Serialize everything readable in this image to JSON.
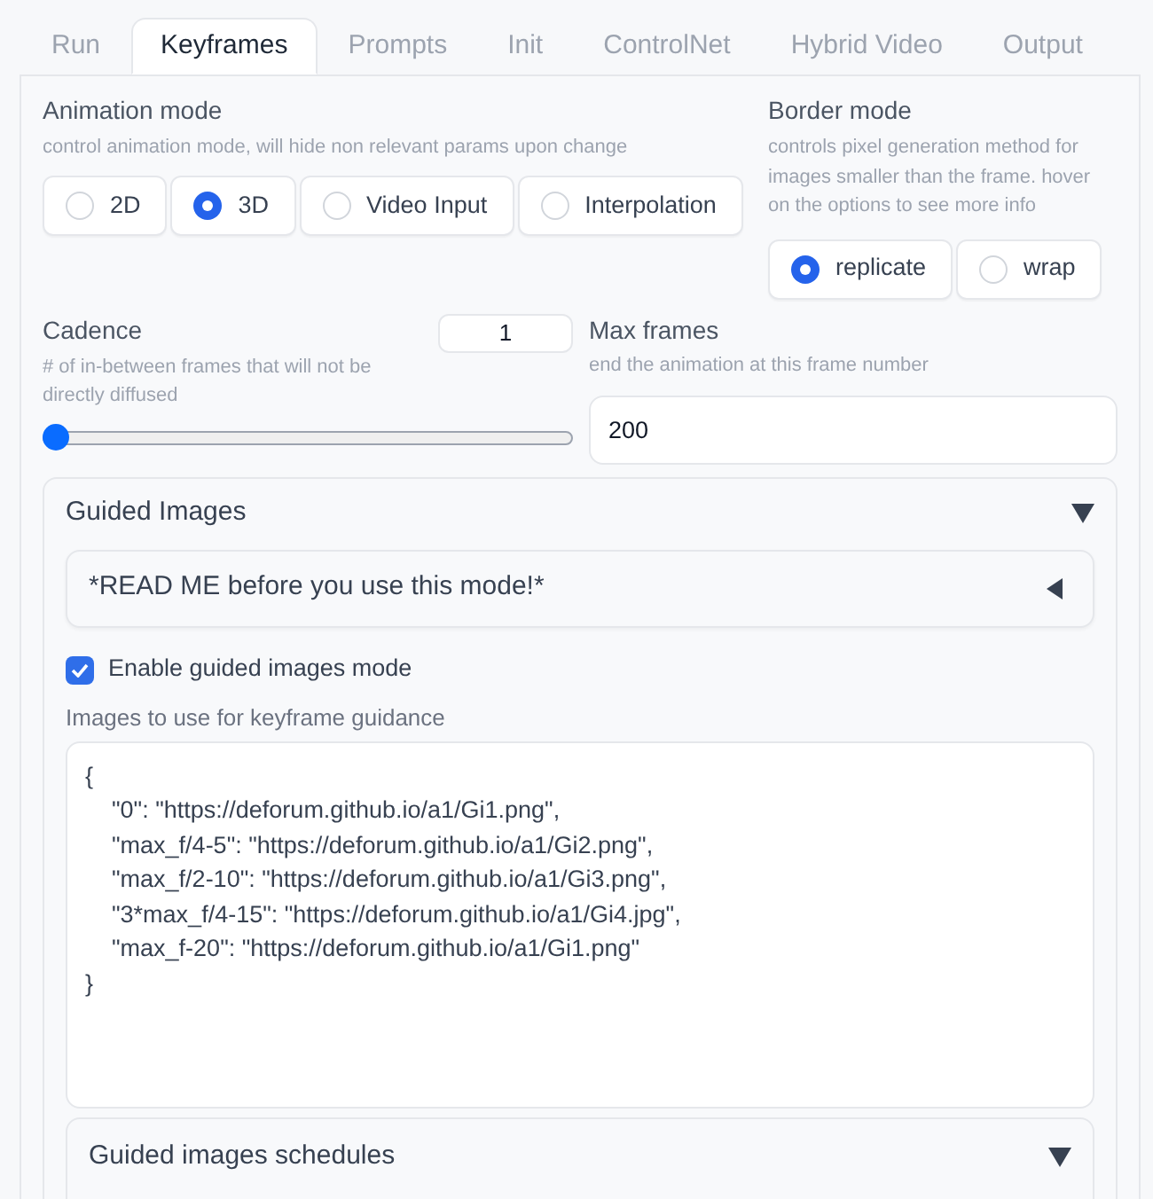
{
  "tabs": [
    {
      "label": "Run",
      "selected": false
    },
    {
      "label": "Keyframes",
      "selected": true
    },
    {
      "label": "Prompts",
      "selected": false
    },
    {
      "label": "Init",
      "selected": false
    },
    {
      "label": "ControlNet",
      "selected": false
    },
    {
      "label": "Hybrid Video",
      "selected": false
    },
    {
      "label": "Output",
      "selected": false
    }
  ],
  "animation_mode": {
    "label": "Animation mode",
    "description": "control animation mode, will hide non relevant params upon change",
    "options": [
      {
        "label": "2D",
        "selected": false
      },
      {
        "label": "3D",
        "selected": true
      },
      {
        "label": "Video Input",
        "selected": false
      },
      {
        "label": "Interpolation",
        "selected": false
      }
    ]
  },
  "border_mode": {
    "label": "Border mode",
    "description": "controls pixel generation method for images smaller than the frame. hover on the options to see more info",
    "options": [
      {
        "label": "replicate",
        "selected": true
      },
      {
        "label": "wrap",
        "selected": false
      }
    ]
  },
  "cadence": {
    "label": "Cadence",
    "value": "1",
    "description": "# of in-between frames that will not be directly diffused",
    "level": 0
  },
  "max_frames": {
    "label": "Max frames",
    "description": "end the animation at this frame number",
    "value": "200"
  },
  "guided_images": {
    "title": "Guided Images",
    "expanded": true,
    "readme": {
      "title": "*READ ME before you use this mode!*",
      "expanded": false
    },
    "enable": {
      "label": "Enable guided images mode",
      "checked": true
    },
    "images": {
      "label": "Images to use for keyframe guidance",
      "value": "{\n    \"0\": \"https://deforum.github.io/a1/Gi1.png\",\n    \"max_f/4-5\": \"https://deforum.github.io/a1/Gi2.png\",\n    \"max_f/2-10\": \"https://deforum.github.io/a1/Gi3.png\",\n    \"3*max_f/4-15\": \"https://deforum.github.io/a1/Gi4.jpg\",\n    \"max_f-20\": \"https://deforum.github.io/a1/Gi1.png\"\n}"
    },
    "schedules": {
      "title": "Guided images schedules",
      "expanded": true
    }
  }
}
